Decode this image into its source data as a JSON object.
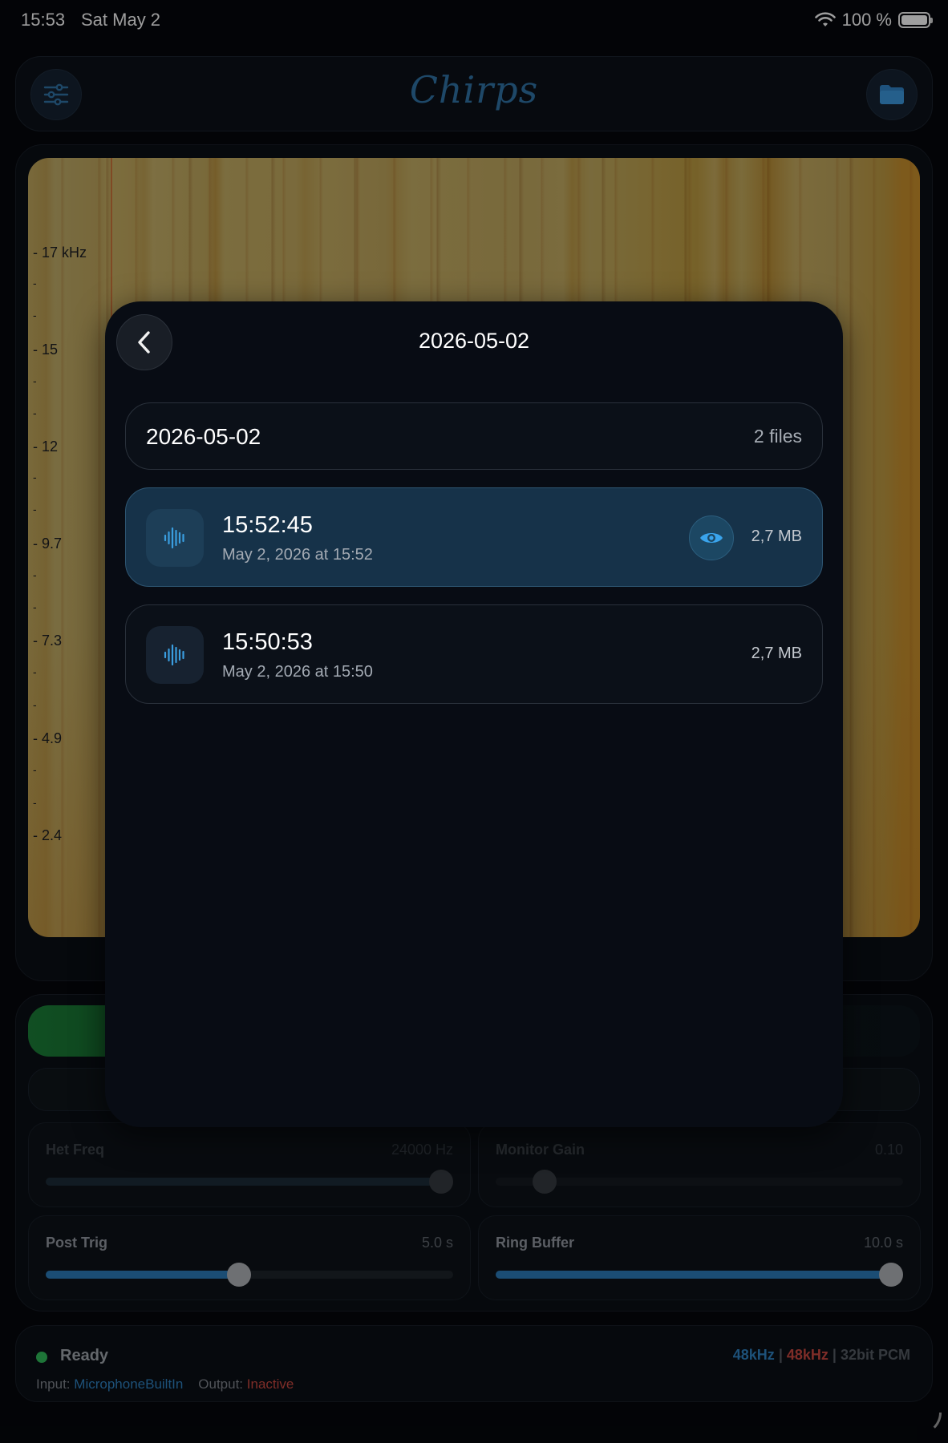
{
  "status_bar": {
    "time": "15:53",
    "date": "Sat May 2",
    "battery_text": "100 %"
  },
  "header": {
    "title": "Chirps",
    "left_icon": "sliders-icon",
    "right_icon": "folder-icon"
  },
  "spectrogram": {
    "y_ticks": [
      "17 kHz",
      "15",
      "12",
      "9.7",
      "7.3",
      "4.9",
      "2.4"
    ]
  },
  "controls": {
    "het_freq": {
      "label": "Het Freq",
      "value": "24000 Hz",
      "fraction": 0.97
    },
    "monitor_gain": {
      "label": "Monitor Gain",
      "value": "0.10",
      "fraction": 0.12
    },
    "post_trig": {
      "label": "Post Trig",
      "value": "5.0 s",
      "fraction": 0.475
    },
    "ring_buffer": {
      "label": "Ring Buffer",
      "value": "10.0 s",
      "fraction": 0.97
    }
  },
  "footer": {
    "status": "Ready",
    "format_a": "48kHz",
    "format_b": "48kHz",
    "format_c": "32bit PCM",
    "separator": "|",
    "input_label": "Input:",
    "input_value": "MicrophoneBuiltIn",
    "output_label": "Output:",
    "output_value": "Inactive"
  },
  "sheet": {
    "title": "2026-05-02",
    "group": {
      "title": "2026-05-02",
      "count": "2 files"
    },
    "files": [
      {
        "name": "15:52:45",
        "date": "May 2, 2026 at 15:52",
        "size": "2,7 MB",
        "selected": true
      },
      {
        "name": "15:50:53",
        "date": "May 2, 2026 at 15:50",
        "size": "2,7 MB",
        "selected": false
      }
    ]
  },
  "colors": {
    "accent": "#2d7dbb",
    "ready": "#2fb457",
    "inactive": "#c2463e",
    "selected_row": "#163249"
  }
}
